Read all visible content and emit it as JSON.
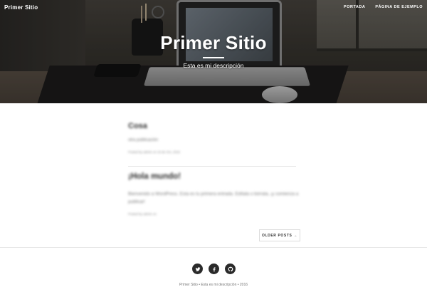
{
  "header": {
    "brand": "Primer Sitio",
    "nav": [
      {
        "label": "Portada"
      },
      {
        "label": "Página de ejemplo"
      }
    ],
    "title": "Primer Sitio",
    "description": "Esta es mi descripción"
  },
  "posts": [
    {
      "title": "Cosa",
      "excerpt": "otra publicación",
      "meta": "Posted by admin on 19 de Oct, 2016"
    },
    {
      "title": "¡Hola mundo!",
      "excerpt": "Bienvenido a WordPress. Esta es tu primera entrada. Edítala o bórrala, ¡y comienza a publicar!",
      "meta": "Posted by admin on"
    }
  ],
  "pagination": {
    "older_label": "Older Posts →"
  },
  "footer": {
    "social": [
      {
        "icon": "twitter-icon"
      },
      {
        "icon": "facebook-icon"
      },
      {
        "icon": "github-icon"
      }
    ],
    "copyright": "Primer Sitio • Esta es mi descripción • 2016"
  },
  "colors": {
    "hero_overlay": "#000000",
    "text_dark": "#2e2e2e",
    "text_muted": "#7a7a7a",
    "social_circle": "#2a2a2a"
  }
}
